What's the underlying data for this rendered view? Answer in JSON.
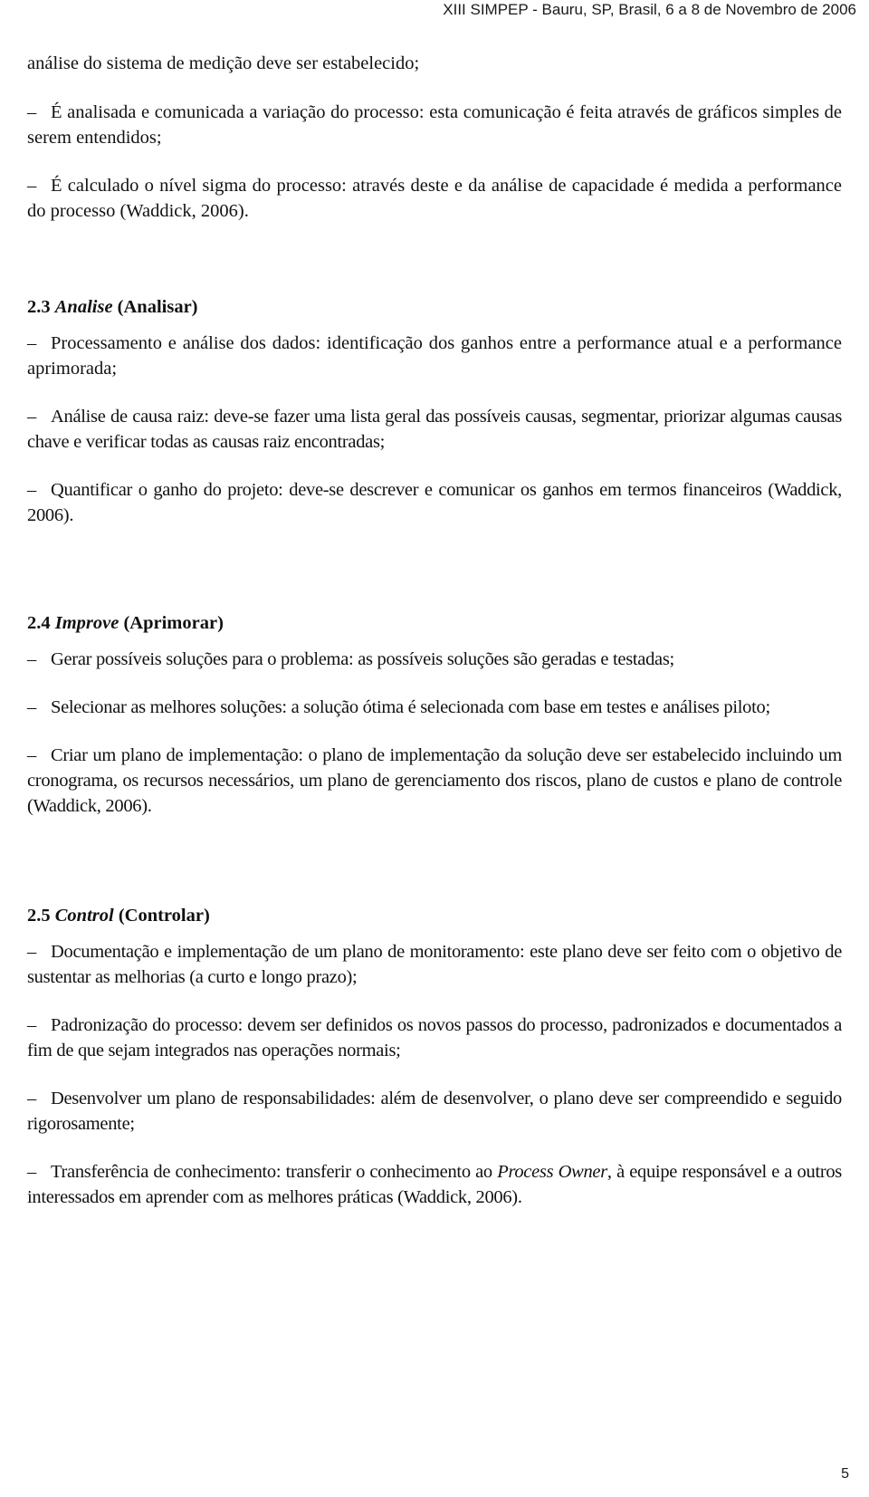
{
  "header": {
    "running_title": "XIII SIMPEP - Bauru, SP, Brasil, 6 a 8 de Novembro de 2006"
  },
  "intro": {
    "continuation": "análise do sistema de medição deve ser estabelecido;",
    "bullets": [
      {
        "text": "É analisada e comunicada a variação do processo: esta comunicação é feita através de gráficos simples de serem entendidos;"
      },
      {
        "text": "É calculado o nível sigma do processo: através deste e da análise de capacidade é medida a performance do processo (Waddick, 2006)."
      }
    ]
  },
  "sections": [
    {
      "number": "2.3",
      "title_en": "Analise",
      "title_pt": "(Analisar)",
      "bullets": [
        {
          "text": "Processamento e análise dos dados: identificação dos ganhos entre a performance atual e a performance aprimorada;"
        },
        {
          "text": "Análise de causa raiz: deve-se fazer uma lista geral das possíveis causas, segmentar, priorizar algumas causas chave e verificar todas as causas raiz encontradas;"
        },
        {
          "text": "Quantificar o ganho do projeto: deve-se descrever e comunicar os ganhos em termos financeiros (Waddick, 2006)."
        }
      ]
    },
    {
      "number": "2.4",
      "title_en": "Improve",
      "title_pt": "(Aprimorar)",
      "bullets": [
        {
          "text": "Gerar possíveis soluções para o problema: as possíveis soluções são geradas e testadas;"
        },
        {
          "text": "Selecionar as melhores soluções: a solução ótima é selecionada com base em testes e análises piloto;"
        },
        {
          "text": "Criar um plano de implementação: o plano de implementação da solução deve ser estabelecido incluindo um cronograma, os recursos necessários, um plano de gerenciamento dos riscos, plano de custos e plano de controle (Waddick, 2006)."
        }
      ]
    },
    {
      "number": "2.5",
      "title_en": "Control",
      "title_pt": "(Controlar)",
      "bullets": [
        {
          "text": "Documentação e implementação de um plano de monitoramento: este plano deve ser feito com o objetivo de sustentar as melhorias (a curto e longo prazo);"
        },
        {
          "text": "Padronização do processo: devem ser definidos os novos passos do processo, padronizados e documentados a fim de que sejam integrados nas operações normais;"
        },
        {
          "text": "Desenvolver um plano de responsabilidades: além de desenvolver, o plano deve ser compreendido e seguido rigorosamente;"
        },
        {
          "text_before": "Transferência de conhecimento: transferir o conhecimento ao ",
          "text_italic": "Process Owner",
          "text_after": ", à equipe responsável e a outros interessados em aprender com as melhores práticas (Waddick, 2006)."
        }
      ]
    }
  ],
  "bullet_marker": "–",
  "footer": {
    "page_number": "5"
  }
}
